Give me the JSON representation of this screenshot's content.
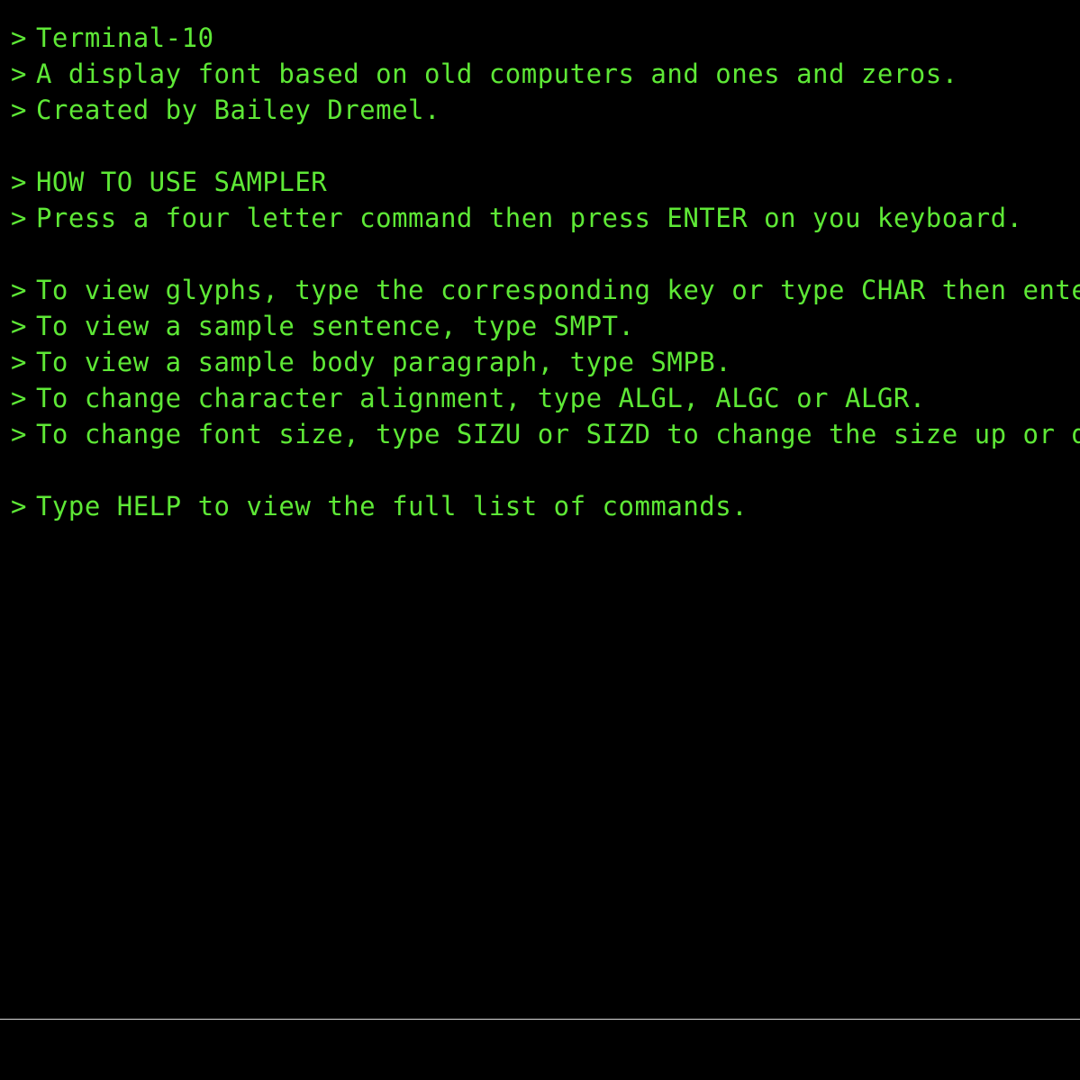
{
  "terminal": {
    "prompt": ">",
    "lines": [
      "Terminal-10",
      "A display font based on old computers and ones and zeros.",
      "Created by Bailey Dremel.",
      "",
      "HOW TO USE SAMPLER",
      "Press a four letter command then press ENTER on you keyboard.",
      "",
      "To view glyphs, type the corresponding key or type CHAR then enter.",
      "To view a sample sentence, type SMPT.",
      "To view a sample body paragraph, type SMPB.",
      "To change character alignment, type ALGL, ALGC or ALGR.",
      "To change font size, type SIZU or SIZD to change the size up or down.",
      "",
      "Type HELP to view the full list of commands."
    ]
  },
  "input": {
    "value": "",
    "placeholder": ""
  },
  "colors": {
    "background": "#000000",
    "text": "#5ee836",
    "divider": "#d8d8d8"
  }
}
